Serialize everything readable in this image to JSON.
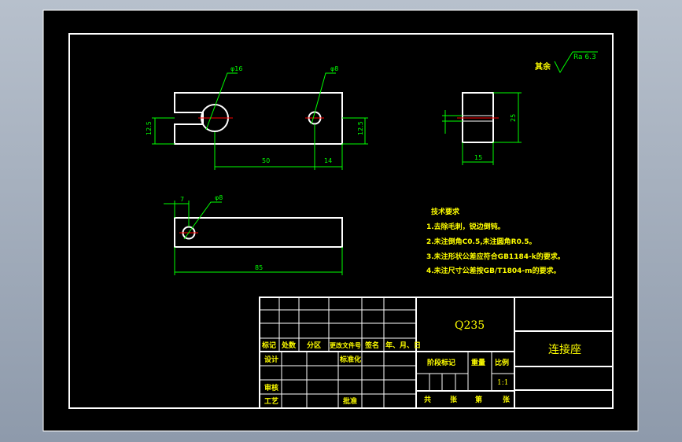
{
  "colors": {
    "paper": "#000000",
    "border": "#ffffff",
    "outline": "#ffffff",
    "dimension": "#00ff00",
    "center": "#ff0000",
    "text": "#ffff00",
    "table_text": "#ffff00",
    "ra_text": "#00ff00"
  },
  "roughness": {
    "label": "其余",
    "value": "Ra 6.3"
  },
  "dimensions": {
    "hole16": "φ16",
    "hole8a": "φ8",
    "hole8b": "φ8",
    "h12_5_left": "12.5",
    "h12_5_right": "12.5",
    "len50": "50",
    "len14": "14",
    "side_h": "25",
    "side_w": "15",
    "len7": "7",
    "len85": "85"
  },
  "notes": {
    "title": "技术要求",
    "items": [
      "1.去除毛刺，锐边倒钝。",
      "2.未注倒角C0.5,未注圆角R0.5。",
      "3.未注形状公差应符合GB1184-k的要求。",
      "4.未注尺寸公差按GB/T1804-m的要求。"
    ]
  },
  "title_block": {
    "material": "Q235",
    "part_name": "连接座",
    "headers": [
      "标记",
      "处数",
      "分区",
      "更改文件号",
      "签名",
      "年、月、日"
    ],
    "design": "设计",
    "standard": "标准化",
    "review": "审核",
    "process": "工艺",
    "approve": "批准",
    "stage_mark": "阶段标记",
    "weight": "重量",
    "ratio": "比例",
    "scale": "1:1",
    "total": "共",
    "sheets1": "张",
    "page": "第",
    "sheets2": "张"
  }
}
